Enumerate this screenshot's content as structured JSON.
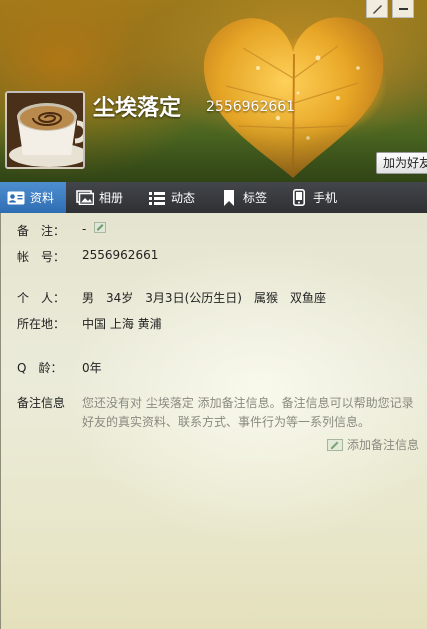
{
  "header": {
    "nickname": "尘埃落定",
    "qq_number": "2556962661",
    "add_friend_label": "加为好友"
  },
  "tabs": [
    {
      "label": "资料",
      "icon": "profile-card-icon",
      "active": true
    },
    {
      "label": "相册",
      "icon": "album-icon",
      "active": false
    },
    {
      "label": "动态",
      "icon": "feed-list-icon",
      "active": false
    },
    {
      "label": "标签",
      "icon": "bookmark-icon",
      "active": false
    },
    {
      "label": "手机",
      "icon": "phone-icon",
      "active": false
    }
  ],
  "profile": {
    "remark_label": "备　注：",
    "remark_value": "-",
    "account_label": "帐　号：",
    "account_value": "2556962661",
    "personal_label": "个　人：",
    "gender": "男",
    "age": "34岁",
    "birthday": "3月3日(公历生日)",
    "zodiac_animal": "属猴",
    "star_sign": "双鱼座",
    "location_label": "所在地：",
    "location_value": "中国 上海 黄浦",
    "qage_label": "Q　龄：",
    "qage_value": "0年"
  },
  "remark_info": {
    "label": "备注信息",
    "line1": "您还没有对 尘埃落定 添加备注信息。备注信息可以帮助您记录",
    "line2": "好友的真实资料、联系方式、事件行为等一系列信息。",
    "add_link": "添加备注信息"
  },
  "colors": {
    "tab_active": "#3a7cc0",
    "tab_bar": "#3a3d41",
    "muted_text": "#8a8a80"
  }
}
